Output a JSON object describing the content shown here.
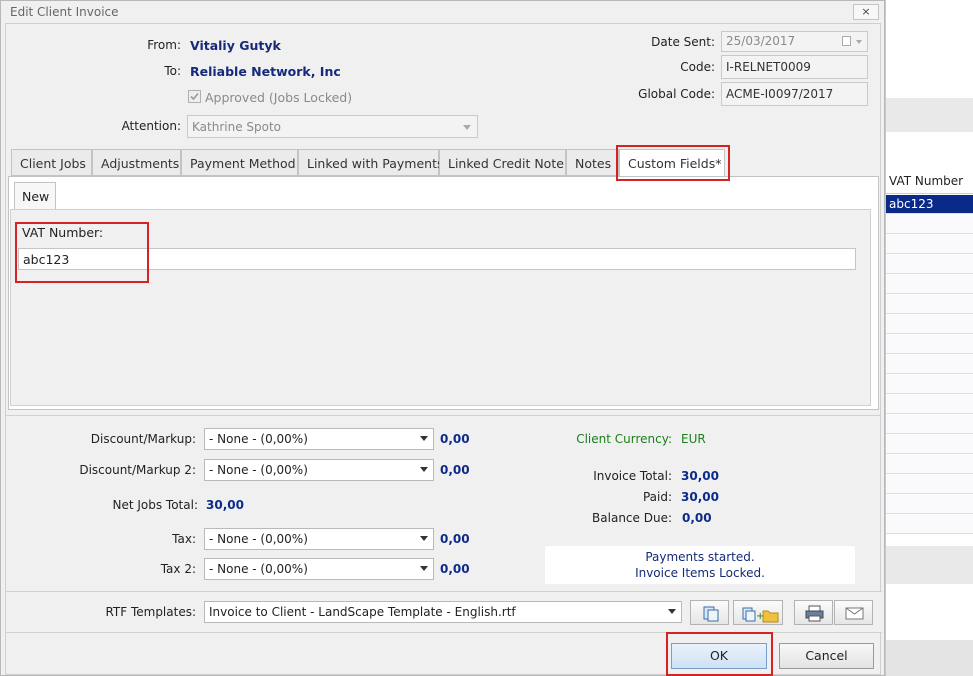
{
  "dialog": {
    "title": "Edit Client Invoice",
    "close_label": "×"
  },
  "header": {
    "from_label": "From:",
    "from_value": "Vitaliy Gutyk",
    "to_label": "To:",
    "to_value": "Reliable Network, Inc",
    "approved_label": "Approved (Jobs Locked)",
    "approved_checked": true,
    "attention_label": "Attention:",
    "attention_value": "Kathrine Spoto",
    "date_sent_label": "Date Sent:",
    "date_sent_value": "25/03/2017",
    "code_label": "Code:",
    "code_value": "I-RELNET0009",
    "global_code_label": "Global Code:",
    "global_code_value": "ACME-I0097/2017"
  },
  "tabs": [
    {
      "label": "Client Jobs"
    },
    {
      "label": "Adjustments"
    },
    {
      "label": "Payment Method"
    },
    {
      "label": "Linked with Payments"
    },
    {
      "label": "Linked Credit Note"
    },
    {
      "label": "Notes"
    },
    {
      "label": "Custom Fields*",
      "active": true
    }
  ],
  "custom_fields": {
    "subtab": "New",
    "vat_label": "VAT Number:",
    "vat_value": "abc123"
  },
  "totals": {
    "discount_label": "Discount/Markup:",
    "discount_value": "- None - (0,00%)",
    "discount_amount": "0,00",
    "discount2_label": "Discount/Markup 2:",
    "discount2_value": "- None - (0,00%)",
    "discount2_amount": "0,00",
    "net_jobs_label": "Net Jobs Total:",
    "net_jobs_value": "30,00",
    "tax_label": "Tax:",
    "tax_value": "- None - (0,00%)",
    "tax_amount": "0,00",
    "tax2_label": "Tax 2:",
    "tax2_value": "- None - (0,00%)",
    "tax2_amount": "0,00",
    "currency_label": "Client Currency:",
    "currency_value": "EUR",
    "invoice_total_label": "Invoice Total:",
    "invoice_total_value": "30,00",
    "paid_label": "Paid:",
    "paid_value": "30,00",
    "balance_label": "Balance Due:",
    "balance_value": "0,00",
    "status_line1": "Payments started.",
    "status_line2": "Invoice Items Locked."
  },
  "templates": {
    "label": "RTF Templates:",
    "value": "Invoice to Client - LandScape Template - English.rtf",
    "buttons": [
      "copy-template-icon",
      "add-folder-icon",
      "print-icon",
      "email-icon"
    ]
  },
  "footer": {
    "ok_label": "OK",
    "cancel_label": "Cancel"
  },
  "background_app": {
    "column_header": "VAT Number",
    "selected_cell": "abc123"
  },
  "colors": {
    "highlight": "#d32424",
    "accent_text": "#152a7a",
    "currency_green": "#1a7f1a",
    "selection": "#0a2a8a"
  }
}
